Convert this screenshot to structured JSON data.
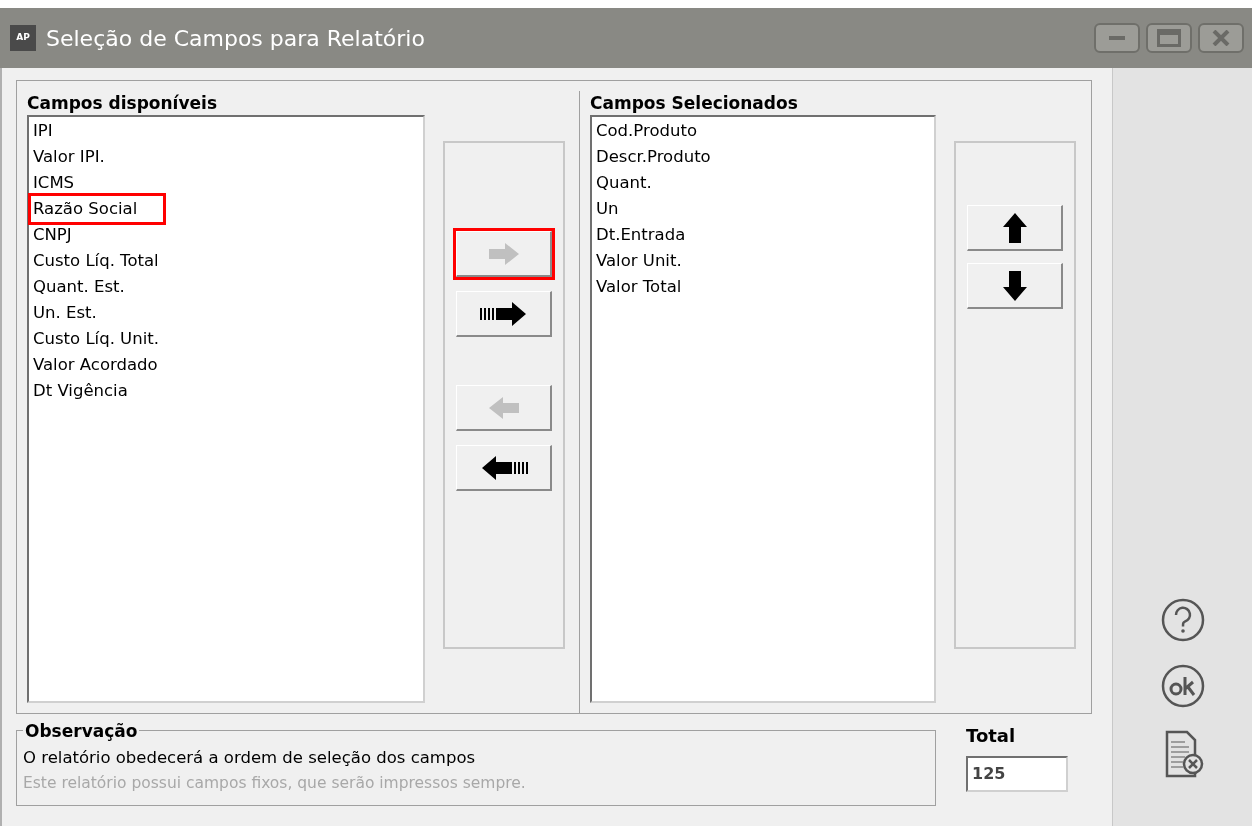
{
  "window": {
    "title": "Seleção de Campos para Relatório",
    "app_badge": "AP"
  },
  "available": {
    "heading": "Campos disponíveis",
    "items": [
      {
        "label": "IPI",
        "highlighted": false
      },
      {
        "label": "Valor IPI.",
        "highlighted": false
      },
      {
        "label": "ICMS",
        "highlighted": false
      },
      {
        "label": "Razão Social",
        "highlighted": true
      },
      {
        "label": "CNPJ",
        "highlighted": false
      },
      {
        "label": "Custo Líq. Total",
        "highlighted": false
      },
      {
        "label": "Quant. Est.",
        "highlighted": false
      },
      {
        "label": "Un. Est.",
        "highlighted": false
      },
      {
        "label": "Custo Líq. Unit.",
        "highlighted": false
      },
      {
        "label": "Valor Acordado",
        "highlighted": false
      },
      {
        "label": "Dt Vigência",
        "highlighted": false
      }
    ]
  },
  "transfer_buttons": [
    {
      "kind": "right",
      "disabled": true,
      "highlighted": true
    },
    {
      "kind": "all-right",
      "disabled": false,
      "highlighted": false
    },
    {
      "kind": "left",
      "disabled": true,
      "highlighted": false
    },
    {
      "kind": "all-left",
      "disabled": false,
      "highlighted": false
    }
  ],
  "selected": {
    "heading": "Campos Selecionados",
    "items": [
      "Cod.Produto",
      "Descr.Produto",
      "Quant.",
      "Un",
      "Dt.Entrada",
      "Valor Unit.",
      "Valor Total"
    ]
  },
  "order_buttons": [
    {
      "kind": "up"
    },
    {
      "kind": "down"
    }
  ],
  "observation": {
    "title": "Observação",
    "text": "O relatório obedecerá a ordem de seleção dos campos",
    "note": "Este relatório possui campos fixos, que serão impressos sempre."
  },
  "total": {
    "label": "Total",
    "value": "125"
  }
}
